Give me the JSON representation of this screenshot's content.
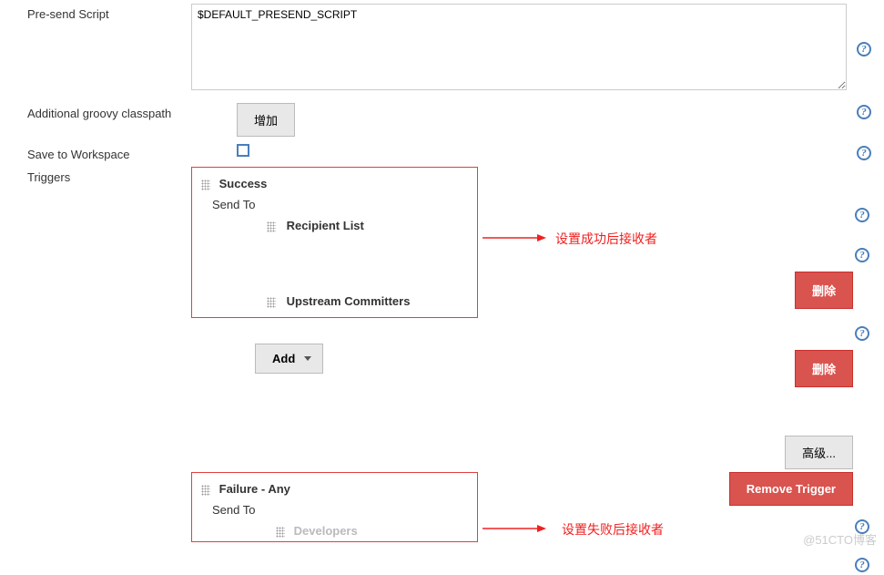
{
  "labels": {
    "presend": "Pre-send Script",
    "classpath": "Additional groovy classpath",
    "saveworkspace": "Save to Workspace",
    "triggers": "Triggers"
  },
  "presend": {
    "value": "$DEFAULT_PRESEND_SCRIPT"
  },
  "buttons": {
    "add_cn": "增加",
    "add_en": "Add",
    "delete_cn": "删除",
    "advanced_cn": "高级...",
    "remove_trigger": "Remove Trigger"
  },
  "triggers": {
    "success": {
      "title": "Success",
      "send_to": "Send To",
      "recipients": [
        "Recipient List",
        "Upstream Committers"
      ]
    },
    "failure": {
      "title": "Failure - Any",
      "send_to": "Send To",
      "recipients_faded": "Developers"
    }
  },
  "annotations": {
    "success": "设置成功后接收者",
    "failure": "设置失败后接收者"
  },
  "watermark": "@51CTO博客",
  "chart_data": null
}
